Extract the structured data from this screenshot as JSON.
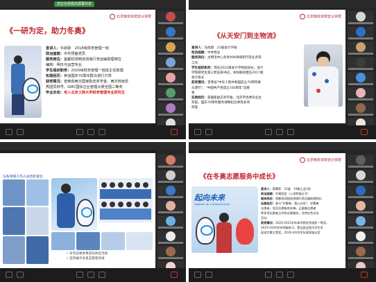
{
  "window": {
    "sharing_indicator": "您正在观看的屏幕共享"
  },
  "q1": {
    "logo": "北京物资学院会计学院",
    "title": "《一研为定，助力冬奥》",
    "info": [
      {
        "label": "宣讲人：",
        "value": "许启豪　2018级财务管理一班"
      },
      {
        "label": "政治面貌：",
        "value": "中共预备党员"
      },
      {
        "label": "服务岗位：",
        "value": "首都机场物流领域行李运输助理岗位"
      },
      {
        "label": "",
        "value": "编岗：明日与运营专业"
      },
      {
        "label": "学生组织职务：",
        "value": "2020级财务管理一班班主任助理"
      },
      {
        "label": "实践经历：",
        "value": "参加国庆70周年群众游行方阵"
      },
      {
        "label": "获奖情况：",
        "value": "曾荣获两次国家励志奖学金、两次校级优"
      },
      {
        "label": "",
        "value": "秀团员称号、GMC国际企业管理大赛全国二等奖"
      },
      {
        "label": "毕业去向：",
        "value": "考入北京工商大学财务管理专业研究生",
        "highlight": true
      }
    ]
  },
  "q2": {
    "logo": "北京物资学院会计学院",
    "title": "《从天安门到主物流》",
    "info": [
      {
        "label": "宣讲人：",
        "value": "马尚翔　21级会计学硕"
      },
      {
        "label": "政治面貌：",
        "value": "中共党员"
      },
      {
        "label": "服务岗位：",
        "value": "主物流中心负责996领域和行李业务等"
      },
      {
        "label": "",
        "value": "工作"
      },
      {
        "label": "学生组织职务：",
        "value": "现任2021级会计学硕班班长，会计"
      },
      {
        "label": "",
        "value": "学院研究生第三党支部书记，本科期间担任2017级"
      },
      {
        "label": "",
        "value": "会计班长"
      },
      {
        "label": "获奖情况：",
        "value": "曾参加\"中华人民共和国成立70周年群"
      },
      {
        "label": "",
        "value": "众游行\"、\"中国共产党成立100周年\"志愿"
      },
      {
        "label": "",
        "value": "者"
      },
      {
        "label": "实践经历：",
        "value": "获国家励志奖学金，北京市优秀毕业生"
      },
      {
        "label": "",
        "value": "荣誉，国庆70周年服务保障纪念章等多项"
      },
      {
        "label": "",
        "value": "荣誉"
      }
    ]
  },
  "q3": {
    "header": "与各领域工作人员合影留念",
    "bullets": [
      "• 岁月前春季青团日体验活动",
      "• 坚持展示冬奥志愿者风采"
    ]
  },
  "q4": {
    "logo": "北京物资学院会计学院",
    "title": "《在冬奥志愿服务中成长》",
    "banner": "起向未来",
    "banner_sub": "Together for a Shared Future",
    "info": [
      {
        "label": "宣讲人：",
        "value": "蔡腾菲　21级　19级工会1班"
      },
      {
        "label": "政治面貌：",
        "value": "共青团员（入党积极分子）"
      },
      {
        "label": "服务岗位：",
        "value": "首都机场物流领域行李运输助理岗位"
      },
      {
        "label": "志愿经历：",
        "value": "参与\"学雷锋，我心向党\"，学雷锋"
      },
      {
        "label": "",
        "value": "志愿者，党员志愿服务先锋，正能量志愿者"
      },
      {
        "label": "",
        "value": "等多项志愿者工作和志愿服务，北京红色文化"
      },
      {
        "label": "",
        "value": "活动"
      },
      {
        "label": "获奖情况：",
        "value": "2020-2021学年本学院优秀组织一等奖，"
      },
      {
        "label": "",
        "value": "2019-2020学年四级练习，第五届全国大学生学"
      },
      {
        "label": "",
        "value": "英语大赛三等奖，2019-2020学年国家励志奖"
      }
    ]
  },
  "colors": {
    "title_red": "#c0272d",
    "highlight_red": "#d9261c",
    "dark_frame": "#1e1e1e"
  }
}
